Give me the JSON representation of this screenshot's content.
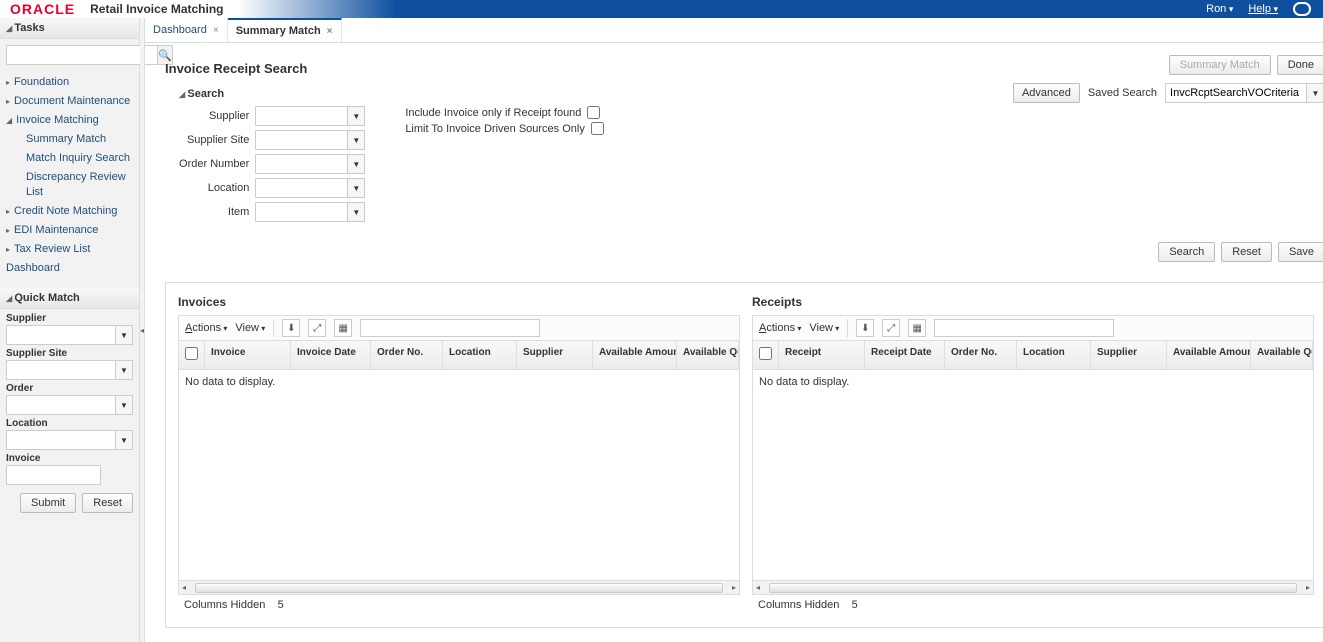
{
  "brand": {
    "logo": "ORACLE",
    "app_title": "Retail Invoice Matching",
    "user": "Ron",
    "help": "Help"
  },
  "sidebar": {
    "tasks_header": "Tasks",
    "quick_match_header": "Quick Match",
    "tree": {
      "foundation": "Foundation",
      "doc_maint": "Document Maintenance",
      "invoice_matching": "Invoice Matching",
      "summary_match": "Summary Match",
      "match_inquiry": "Match Inquiry Search",
      "discrepancy": "Discrepancy Review List",
      "credit_note": "Credit Note Matching",
      "edi": "EDI Maintenance",
      "tax_review": "Tax Review List",
      "dashboard": "Dashboard"
    },
    "qm": {
      "supplier": "Supplier",
      "supplier_site": "Supplier Site",
      "order": "Order",
      "location": "Location",
      "invoice": "Invoice",
      "submit": "Submit",
      "reset": "Reset"
    }
  },
  "tabs": {
    "dashboard": "Dashboard",
    "summary_match": "Summary Match"
  },
  "page": {
    "title": "Invoice Receipt Search",
    "summary_match_btn": "Summary Match",
    "done_btn": "Done",
    "search_header": "Search",
    "fields": {
      "supplier": "Supplier",
      "supplier_site": "Supplier Site",
      "order_number": "Order Number",
      "location": "Location",
      "item": "Item"
    },
    "checks": {
      "include_invoice": "Include Invoice only if Receipt found",
      "limit_sources": "Limit To Invoice Driven Sources Only"
    },
    "advanced": "Advanced",
    "saved_search_label": "Saved Search",
    "saved_search_value": "InvcRcptSearchVOCriteria",
    "search": "Search",
    "reset": "Reset",
    "save": "Save"
  },
  "grids": {
    "actions": "Actions",
    "view": "View",
    "no_data": "No data to display.",
    "columns_hidden": "Columns Hidden",
    "columns_hidden_count": "5",
    "invoices": {
      "title": "Invoices",
      "cols": [
        "Invoice",
        "Invoice Date",
        "Order No.",
        "Location",
        "Supplier",
        "Available Amount",
        "Available Quantity"
      ]
    },
    "receipts": {
      "title": "Receipts",
      "cols": [
        "Receipt",
        "Receipt Date",
        "Order No.",
        "Location",
        "Supplier",
        "Available Amount",
        "Available Quantity"
      ]
    }
  }
}
